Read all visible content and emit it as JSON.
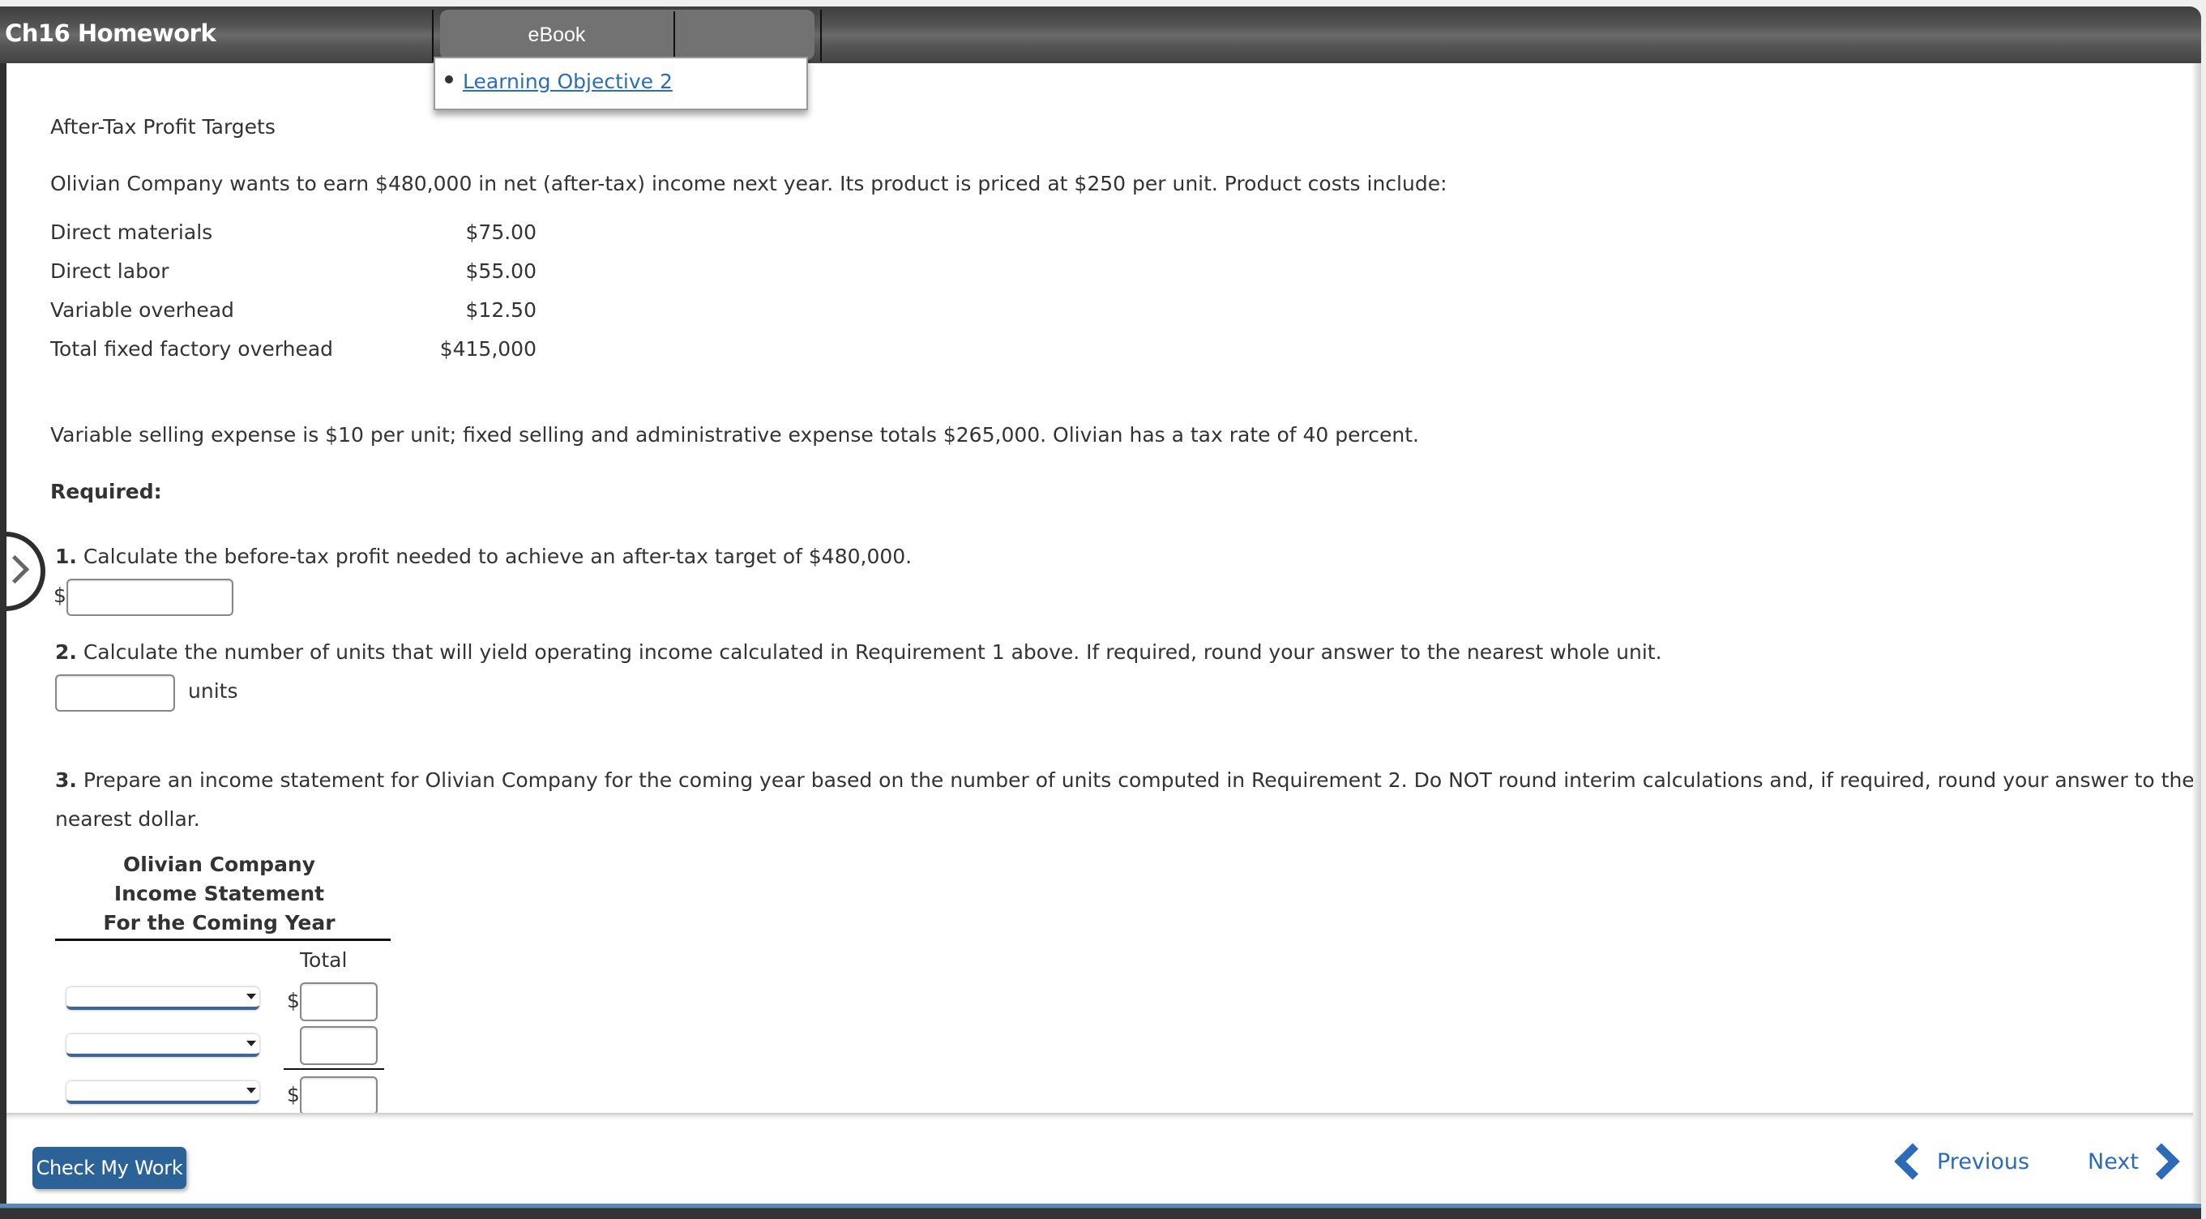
{
  "header": {
    "title": "Ch16 Homework",
    "tabs": [
      {
        "label": "eBook",
        "active": true
      },
      {
        "label": ""
      }
    ],
    "ebook_menu": {
      "items": [
        {
          "label": "Learning Objective 2"
        }
      ]
    }
  },
  "problem": {
    "title": "After-Tax Profit Targets",
    "intro": "Olivian Company wants to earn $480,000 in net (after-tax) income next year. Its product is priced at $250 per unit. Product costs include:",
    "costs": [
      {
        "label": "Direct materials",
        "value": "$75.00"
      },
      {
        "label": "Direct labor",
        "value": "$55.00"
      },
      {
        "label": "Variable overhead",
        "value": "$12.50"
      },
      {
        "label": "Total fixed factory overhead",
        "value": "$415,000"
      }
    ],
    "selling_text": "Variable selling expense is $10 per unit; fixed selling and administrative expense totals $265,000. Olivian has a tax rate of 40 percent.",
    "required_label": "Required:"
  },
  "requirements": {
    "r1": {
      "number": "1.",
      "text": " Calculate the before-tax profit needed to achieve an after-tax target of $480,000.",
      "prefix": "$",
      "value": ""
    },
    "r2": {
      "number": "2.",
      "text": " Calculate the number of units that will yield operating income calculated in Requirement 1 above. If required, round your answer to the nearest whole unit.",
      "value": "",
      "suffix": "units"
    },
    "r3": {
      "number": "3.",
      "text_line1": " Prepare an income statement for Olivian Company for the coming year based on the number of units computed in Requirement 2. Do NOT round interim calculations and, if required, round your answer to the",
      "text_line2": "nearest dollar."
    }
  },
  "income_statement": {
    "company": "Olivian Company",
    "title": "Income Statement",
    "period": "For the Coming Year",
    "column_header": "Total",
    "rows": [
      {
        "select_value": "",
        "prefix": "$",
        "value": ""
      },
      {
        "select_value": "",
        "prefix": "",
        "value": ""
      },
      {
        "select_value": "",
        "prefix": "$",
        "value": ""
      }
    ]
  },
  "footer": {
    "check_label": "Check My Work",
    "previous_label": "Previous",
    "next_label": "Next"
  }
}
